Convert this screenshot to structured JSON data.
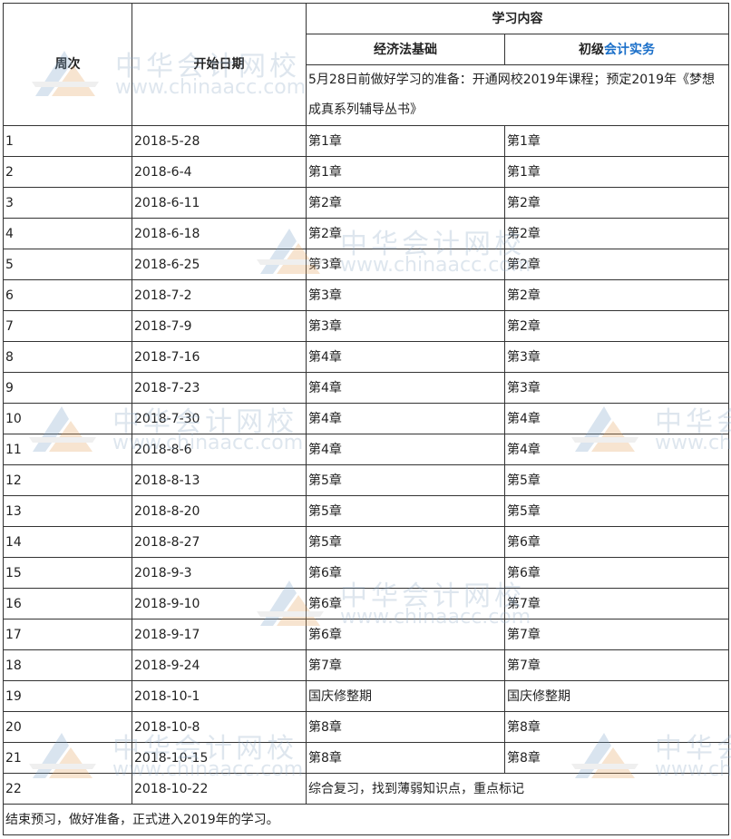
{
  "header": {
    "week": "周次",
    "start_date": "开始日期",
    "study_content": "学习内容",
    "subject1": "经济法基础",
    "subject2_prefix": "初级",
    "subject2_highlight": "会计实务",
    "prep_note": "5月28日前做好学习的准备：开通网校2019年课程；预定2019年《梦想成真系列辅导丛书》"
  },
  "rows": [
    {
      "week": "1",
      "date": "2018-5-28",
      "s1": "第1章",
      "s2": "第1章"
    },
    {
      "week": "2",
      "date": "2018-6-4",
      "s1": "第1章",
      "s2": "第1章"
    },
    {
      "week": "3",
      "date": "2018-6-11",
      "s1": "第2章",
      "s2": "第2章"
    },
    {
      "week": "4",
      "date": "2018-6-18",
      "s1": "第2章",
      "s2": "第2章"
    },
    {
      "week": "5",
      "date": "2018-6-25",
      "s1": "第3章",
      "s2": "第2章"
    },
    {
      "week": "6",
      "date": "2018-7-2",
      "s1": "第3章",
      "s2": "第2章"
    },
    {
      "week": "7",
      "date": "2018-7-9",
      "s1": "第3章",
      "s2": "第2章"
    },
    {
      "week": "8",
      "date": "2018-7-16",
      "s1": "第4章",
      "s2": "第3章"
    },
    {
      "week": "9",
      "date": "2018-7-23",
      "s1": "第4章",
      "s2": "第3章"
    },
    {
      "week": "10",
      "date": "2018-7-30",
      "s1": "第4章",
      "s2": "第4章"
    },
    {
      "week": "11",
      "date": "2018-8-6",
      "s1": "第4章",
      "s2": "第4章"
    },
    {
      "week": "12",
      "date": "2018-8-13",
      "s1": "第5章",
      "s2": "第5章"
    },
    {
      "week": "13",
      "date": "2018-8-20",
      "s1": "第5章",
      "s2": "第5章"
    },
    {
      "week": "14",
      "date": "2018-8-27",
      "s1": "第5章",
      "s2": "第6章"
    },
    {
      "week": "15",
      "date": "2018-9-3",
      "s1": "第6章",
      "s2": "第6章"
    },
    {
      "week": "16",
      "date": "2018-9-10",
      "s1": "第6章",
      "s2": "第7章"
    },
    {
      "week": "17",
      "date": "2018-9-17",
      "s1": "第6章",
      "s2": "第7章"
    },
    {
      "week": "18",
      "date": "2018-9-24",
      "s1": "第7章",
      "s2": "第7章"
    },
    {
      "week": "19",
      "date": "2018-10-1",
      "s1": "国庆修整期",
      "s2": "国庆修整期"
    },
    {
      "week": "20",
      "date": "2018-10-8",
      "s1": "第8章",
      "s2": "第8章"
    },
    {
      "week": "21",
      "date": "2018-10-15",
      "s1": "第8章",
      "s2": "第8章"
    }
  ],
  "last_row": {
    "week": "22",
    "date": "2018-10-22",
    "content": "综合复习，找到薄弱知识点，重点标记"
  },
  "footer_note": "结束预习，做好准备，正式进入2019年的学习。",
  "watermark": {
    "cn": "中华会计网校",
    "url": "www.chinaacc.com"
  },
  "colors": {
    "highlight": "#1a6fc9",
    "border": "#333333",
    "watermark": "#8aa7c4"
  }
}
